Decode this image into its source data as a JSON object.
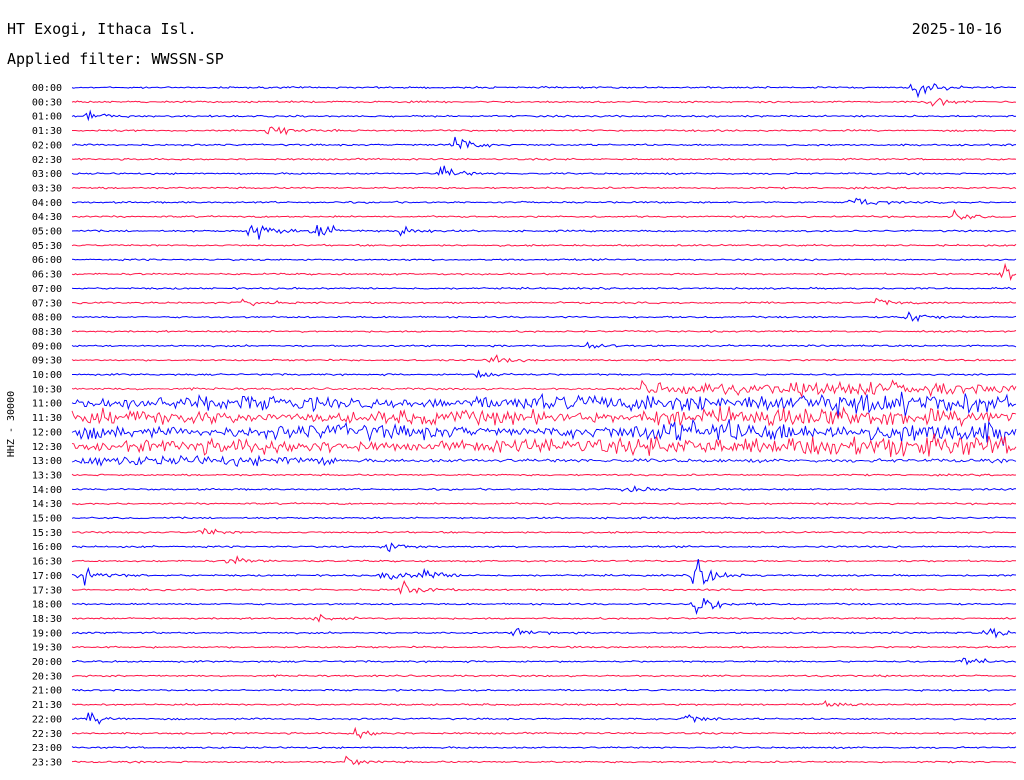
{
  "header": {
    "station": "HT Exogi, Ithaca Isl.",
    "date": "2025-10-16",
    "filter": "Applied filter: WWSSN-SP"
  },
  "chart_data": {
    "type": "line",
    "title": "HT Exogi, Ithaca Isl.",
    "subtitle": "Applied filter: WWSSN-SP",
    "ylabel": "HHZ - 30000",
    "row_labels": [
      "00:00",
      "00:30",
      "01:00",
      "01:30",
      "02:00",
      "02:30",
      "03:00",
      "03:30",
      "04:00",
      "04:30",
      "05:00",
      "05:30",
      "06:00",
      "06:30",
      "07:00",
      "07:30",
      "08:00",
      "08:30",
      "09:00",
      "09:30",
      "10:00",
      "10:30",
      "11:00",
      "11:30",
      "12:00",
      "12:30",
      "13:00",
      "13:30",
      "14:00",
      "14:30",
      "15:00",
      "15:30",
      "16:00",
      "16:30",
      "17:00",
      "17:30",
      "18:00",
      "18:30",
      "19:00",
      "19:30",
      "20:00",
      "20:30",
      "21:00",
      "21:30",
      "22:00",
      "22:30",
      "23:00",
      "23:30"
    ],
    "x_unit": "minutes within 30-minute trace",
    "xlim": [
      0,
      30
    ],
    "series_colors": [
      "#0000ff",
      "#ff1447"
    ],
    "color_rule": "alternating per row, starting blue",
    "noisy_rows": [
      "10:30",
      "11:00",
      "11:30",
      "12:00",
      "12:30",
      "13:00"
    ],
    "events": [
      {
        "row": "00:00",
        "minute": 26.8,
        "amp": 1.3
      },
      {
        "row": "00:30",
        "minute": 27.3,
        "amp": 0.6
      },
      {
        "row": "01:00",
        "minute": 0.4,
        "amp": 0.8
      },
      {
        "row": "01:30",
        "minute": 6.2,
        "amp": 1.0
      },
      {
        "row": "02:00",
        "minute": 12.1,
        "amp": 1.2
      },
      {
        "row": "03:00",
        "minute": 11.7,
        "amp": 1.0
      },
      {
        "row": "04:00",
        "minute": 24.8,
        "amp": 0.8
      },
      {
        "row": "04:30",
        "minute": 28.0,
        "amp": 0.6
      },
      {
        "row": "05:00",
        "minute": 5.7,
        "amp": 1.6
      },
      {
        "row": "05:00",
        "minute": 7.7,
        "amp": 1.3
      },
      {
        "row": "05:00",
        "minute": 10.4,
        "amp": 0.7
      },
      {
        "row": "06:30",
        "minute": 29.6,
        "amp": 1.0
      },
      {
        "row": "07:30",
        "minute": 5.4,
        "amp": 0.7
      },
      {
        "row": "07:30",
        "minute": 25.5,
        "amp": 0.6
      },
      {
        "row": "08:00",
        "minute": 26.5,
        "amp": 1.0
      },
      {
        "row": "09:00",
        "minute": 16.3,
        "amp": 0.5
      },
      {
        "row": "09:30",
        "minute": 13.4,
        "amp": 0.5
      },
      {
        "row": "10:00",
        "minute": 12.9,
        "amp": 0.6
      },
      {
        "row": "14:00",
        "minute": 17.6,
        "amp": 0.6
      },
      {
        "row": "15:30",
        "minute": 4.1,
        "amp": 0.6
      },
      {
        "row": "16:00",
        "minute": 9.9,
        "amp": 0.7
      },
      {
        "row": "16:30",
        "minute": 5.0,
        "amp": 0.6
      },
      {
        "row": "17:00",
        "minute": 0.3,
        "amp": 1.1
      },
      {
        "row": "17:00",
        "minute": 9.9,
        "amp": 0.9
      },
      {
        "row": "17:00",
        "minute": 11.1,
        "amp": 1.0
      },
      {
        "row": "17:00",
        "minute": 19.8,
        "amp": 2.4
      },
      {
        "row": "17:30",
        "minute": 10.5,
        "amp": 0.9
      },
      {
        "row": "18:00",
        "minute": 19.8,
        "amp": 1.6
      },
      {
        "row": "18:30",
        "minute": 7.8,
        "amp": 0.5
      },
      {
        "row": "19:00",
        "minute": 14.1,
        "amp": 0.6
      },
      {
        "row": "19:00",
        "minute": 29.1,
        "amp": 0.6
      },
      {
        "row": "20:00",
        "minute": 28.3,
        "amp": 0.7
      },
      {
        "row": "21:30",
        "minute": 23.9,
        "amp": 0.7
      },
      {
        "row": "22:00",
        "minute": 0.5,
        "amp": 0.8
      },
      {
        "row": "22:00",
        "minute": 19.5,
        "amp": 0.7
      },
      {
        "row": "22:30",
        "minute": 9.0,
        "amp": 0.7
      },
      {
        "row": "23:30",
        "minute": 8.7,
        "amp": 0.6
      }
    ]
  }
}
